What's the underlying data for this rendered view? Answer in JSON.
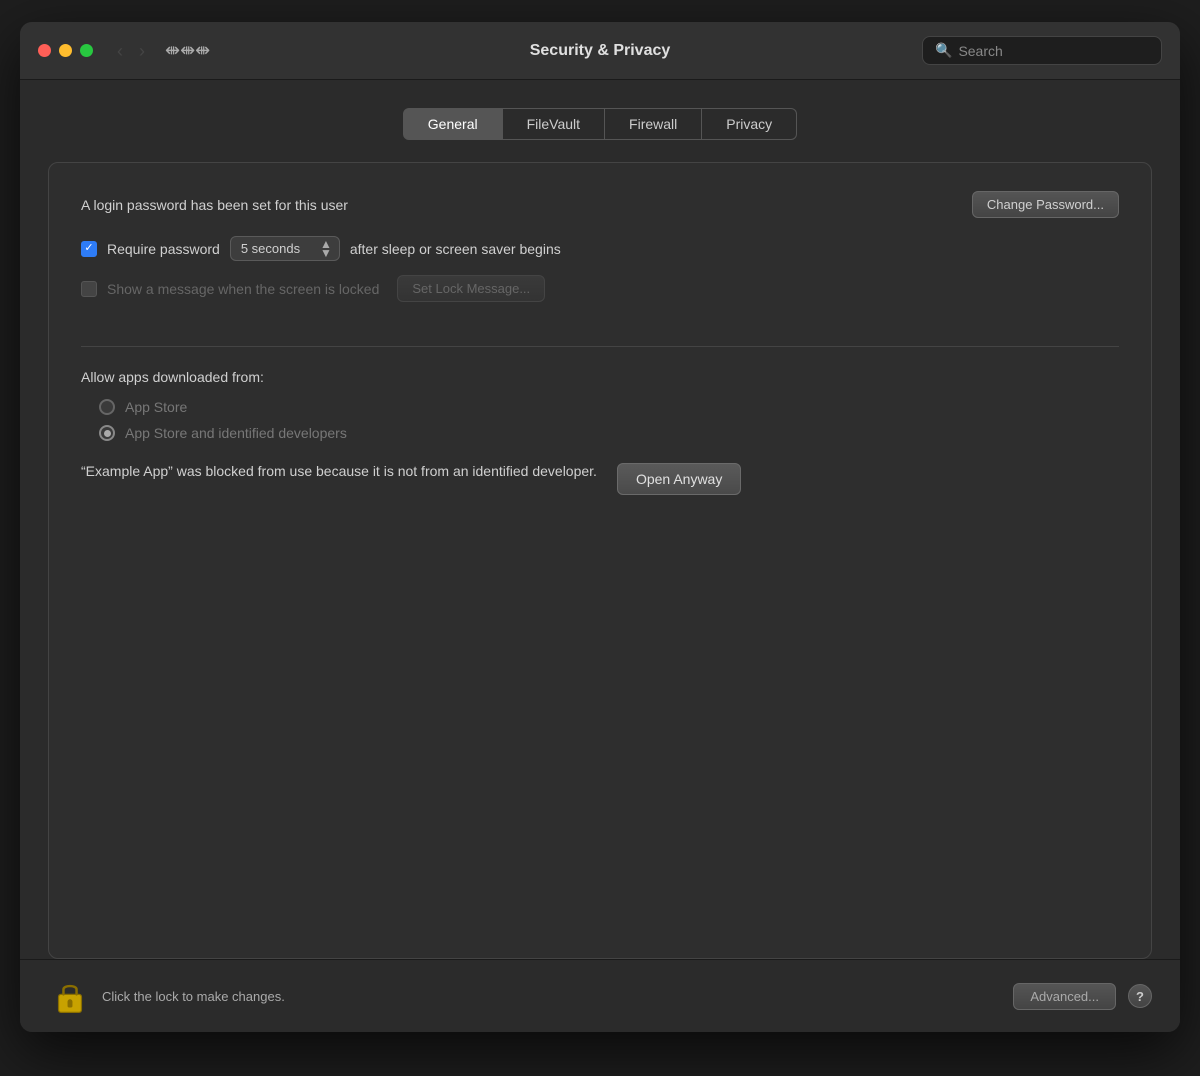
{
  "window": {
    "title": "Security & Privacy",
    "search_placeholder": "Search"
  },
  "tabs": [
    {
      "id": "general",
      "label": "General",
      "active": true
    },
    {
      "id": "filevault",
      "label": "FileVault",
      "active": false
    },
    {
      "id": "firewall",
      "label": "Firewall",
      "active": false
    },
    {
      "id": "privacy",
      "label": "Privacy",
      "active": false
    }
  ],
  "general": {
    "password_label": "A login password has been set for this user",
    "change_password_btn": "Change Password...",
    "require_password_label": "Require password",
    "require_password_checked": true,
    "password_time": "5 seconds",
    "after_label": "after sleep or screen saver begins",
    "lock_message_label": "Show a message when the screen is locked",
    "lock_message_checked": false,
    "set_lock_message_btn": "Set Lock Message...",
    "allow_apps_label": "Allow apps downloaded from:",
    "radio_app_store": "App Store",
    "radio_app_store_identified": "App Store and identified developers",
    "blocked_text": "“Example App” was blocked from use because it is not from an identified developer.",
    "open_anyway_btn": "Open Anyway"
  },
  "bottom": {
    "lock_text": "Click the lock to make changes.",
    "advanced_btn": "Advanced...",
    "help_label": "?"
  },
  "icons": {
    "close": "close-icon",
    "minimize": "minimize-icon",
    "maximize": "maximize-icon",
    "back": "‹",
    "forward": "›",
    "grid": "⁙",
    "search": "🔍",
    "lock": "lock-icon"
  }
}
